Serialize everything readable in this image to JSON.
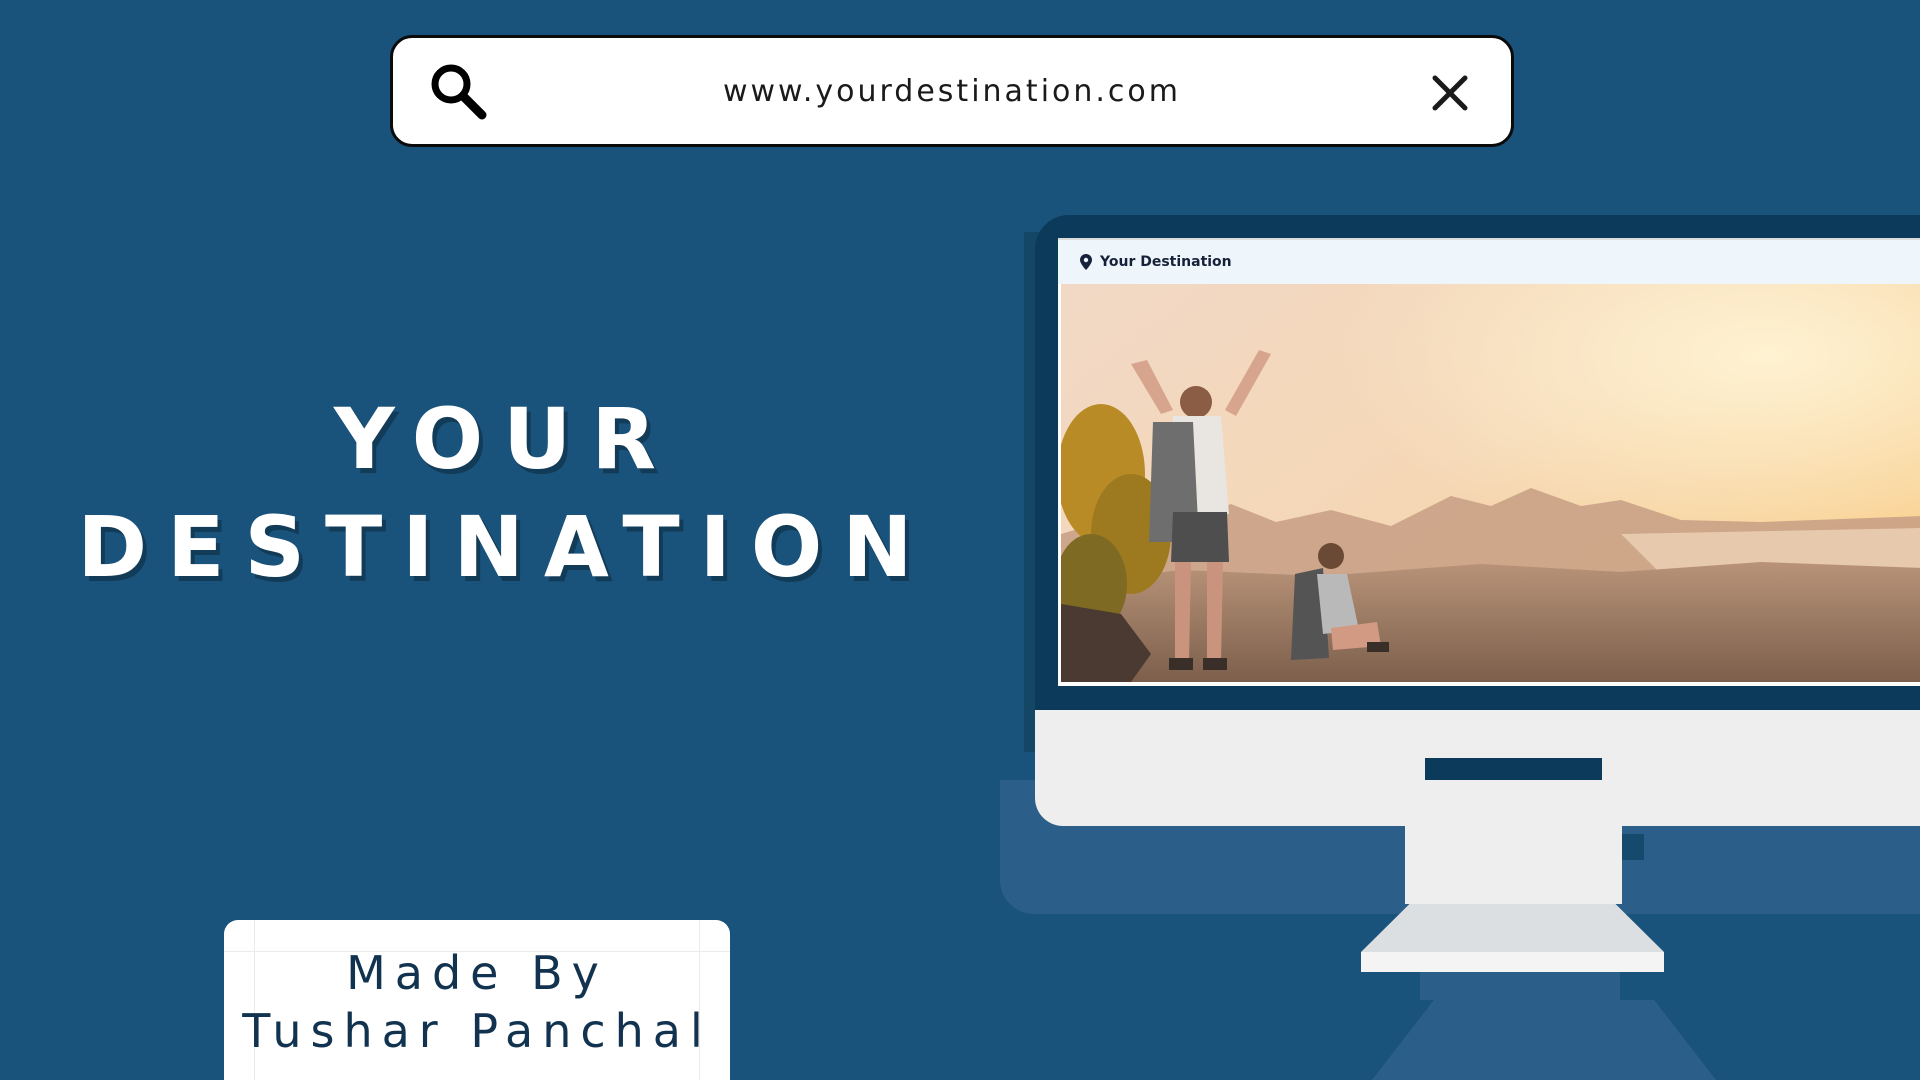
{
  "search_bar": {
    "url": "www.yourdestination.com",
    "left_icon": "search-icon",
    "right_icon": "close-icon"
  },
  "hero": {
    "line1": "YOUR",
    "line2": "DESTINATION"
  },
  "credit": {
    "line1": "Made By",
    "line2": "Tushar Panchal"
  },
  "monitor": {
    "site_icon": "location-pin-icon",
    "site_name": "Your Destination",
    "photo": "travel-hikers-sunset-photo"
  },
  "colors": {
    "background": "#19527a",
    "bezel": "#0c3a5b",
    "monitor_body": "#eeeeee",
    "title": "#ffffff",
    "credit_text": "#12334f"
  }
}
